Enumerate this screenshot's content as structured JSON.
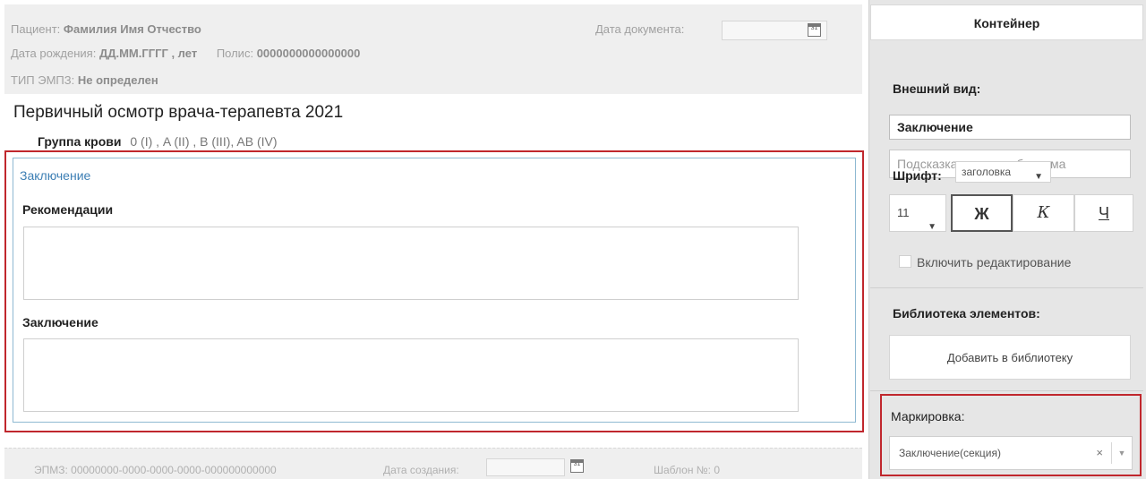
{
  "document": {
    "patient_label": "Пациент:",
    "patient_value": "Фамилия Имя Отчество",
    "birth_label": "Дата рождения:",
    "birth_value": "ДД.ММ.ГГГГ , лет",
    "policy_label": "Полис:",
    "policy_value": "0000000000000000",
    "emz_type_label": "ТИП ЭМПЗ:",
    "emz_type_value": "Не определен",
    "doc_date_label": "Дата документа:",
    "doc_date_value": "",
    "title": "Первичный осмотр врача-терапевта 2021",
    "blood_label": "Группа крови",
    "blood_options": "0 (I) , A (II) , B (III), AB (IV)",
    "section": {
      "title": "Заключение",
      "fields": [
        {
          "label": "Рекомендации",
          "value": ""
        },
        {
          "label": "Заключение",
          "value": ""
        }
      ]
    },
    "footer": {
      "epmz": "ЭПМЗ: 00000000-0000-0000-0000-000000000000",
      "created_label": "Дата создания:",
      "created_value": "",
      "template": "Шаблон №: 0"
    }
  },
  "panel": {
    "header": "Контейнер",
    "appearance_title": "Внешний вид:",
    "name_value": "Заключение",
    "hint_placeholder": "Подсказка, если необходима",
    "font_label": "Шрифт:",
    "font_value": "заголовка",
    "size_value": "11",
    "bold_label": "Ж",
    "italic_label": "К",
    "underline_label": "Ч",
    "enable_edit_label": "Включить редактирование",
    "library_title": "Библиотека элементов:",
    "add_library_button": "Добавить в библиотеку",
    "marking_title": "Маркировка:",
    "marking_value": "Заключение(секция)",
    "marking_clear": "×"
  },
  "icons": {
    "calendar": "calendar-icon",
    "chevron": "chevron-down-icon"
  },
  "colors": {
    "highlight": "#c0272d",
    "section_title": "#3d7fb4",
    "section_border": "#8fb9d2"
  }
}
